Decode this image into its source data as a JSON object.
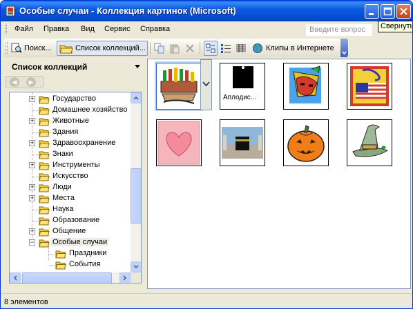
{
  "window": {
    "title": "Особые случаи - Коллекция картинок (Microsoft)",
    "tooltip": "Свернуть"
  },
  "menu": {
    "items": [
      "Файл",
      "Правка",
      "Вид",
      "Сервис",
      "Справка"
    ],
    "ask_placeholder": "Введите вопрос"
  },
  "toolbar": {
    "search_label": "Поиск...",
    "collections_label": "Список коллекций...",
    "clips_online_label": "Клипы в Интернете"
  },
  "collections_pane": {
    "title": "Список коллекций",
    "tree": [
      {
        "label": "Государство",
        "expandable": true
      },
      {
        "label": "Домашнее хозяйство",
        "expandable": false
      },
      {
        "label": "Животные",
        "expandable": true
      },
      {
        "label": "Здания",
        "expandable": false
      },
      {
        "label": "Здравоохранение",
        "expandable": true
      },
      {
        "label": "Знаки",
        "expandable": false
      },
      {
        "label": "Инструменты",
        "expandable": true
      },
      {
        "label": "Искусство",
        "expandable": false
      },
      {
        "label": "Люди",
        "expandable": true
      },
      {
        "label": "Места",
        "expandable": true
      },
      {
        "label": "Наука",
        "expandable": false
      },
      {
        "label": "Образование",
        "expandable": false
      },
      {
        "label": "Общение",
        "expandable": true
      },
      {
        "label": "Особые случаи",
        "expandable": true,
        "expanded": true,
        "selected": true
      },
      {
        "label": "Праздники",
        "child": true
      },
      {
        "label": "События",
        "child": true
      }
    ]
  },
  "clips": [
    {
      "name": "candles-clip",
      "label": ""
    },
    {
      "name": "applause-clip",
      "label": "Аплодис..."
    },
    {
      "name": "mask-clip",
      "label": ""
    },
    {
      "name": "flag-party-clip",
      "label": ""
    },
    {
      "name": "heart-clip",
      "label": ""
    },
    {
      "name": "kaaba-clip",
      "label": ""
    },
    {
      "name": "pumpkin-clip",
      "label": ""
    },
    {
      "name": "witch-hat-clip",
      "label": ""
    }
  ],
  "status": {
    "text": "8 элементов"
  }
}
